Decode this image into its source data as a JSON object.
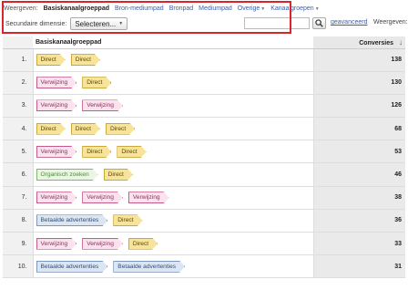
{
  "toolbar": {
    "view_label": "Weergeven:",
    "tabs": [
      {
        "label": "Basiskanaalgroeppad",
        "active": true,
        "caret": false
      },
      {
        "label": "Bron-mediumpad",
        "active": false,
        "caret": false
      },
      {
        "label": "Bronpad",
        "active": false,
        "caret": false
      },
      {
        "label": "Mediumpad",
        "active": false,
        "caret": false
      },
      {
        "label": "Overige",
        "active": false,
        "caret": true
      },
      {
        "label": "Kanaalgroepen",
        "active": false,
        "caret": true
      }
    ]
  },
  "secondary": {
    "label": "Secundaire dimensie:",
    "select_value": "Selecteren...",
    "search_value": "",
    "advanced_link": "geavanceerd",
    "view_label": "Weergeven:"
  },
  "table": {
    "col_path": "Basiskanaalgroeppad",
    "col_conversions": "Conversies",
    "rows": [
      {
        "num": "1.",
        "chips": [
          "Direct",
          "Direct"
        ],
        "value": "138"
      },
      {
        "num": "2.",
        "chips": [
          "Verwijzing",
          "Direct"
        ],
        "value": "130"
      },
      {
        "num": "3.",
        "chips": [
          "Verwijzing",
          "Verwijzing"
        ],
        "value": "126"
      },
      {
        "num": "4.",
        "chips": [
          "Direct",
          "Direct",
          "Direct"
        ],
        "value": "68"
      },
      {
        "num": "5.",
        "chips": [
          "Verwijzing",
          "Direct",
          "Direct"
        ],
        "value": "53"
      },
      {
        "num": "6.",
        "chips": [
          "Organisch zoeken",
          "Direct"
        ],
        "value": "46"
      },
      {
        "num": "7.",
        "chips": [
          "Verwijzing",
          "Verwijzing",
          "Verwijzing"
        ],
        "value": "38"
      },
      {
        "num": "8.",
        "chips": [
          "Betaalde advertenties",
          "Direct"
        ],
        "value": "36"
      },
      {
        "num": "9.",
        "chips": [
          "Verwijzing",
          "Verwijzing",
          "Direct"
        ],
        "value": "33"
      },
      {
        "num": "10.",
        "chips": [
          "Betaalde advertenties",
          "Betaalde advertenties"
        ],
        "value": "31"
      }
    ]
  },
  "chip_types": {
    "Direct": "chip-direct",
    "Verwijzing": "chip-verwijzing",
    "Organisch zoeken": "chip-organisch",
    "Betaalde advertenties": "chip-betaald"
  },
  "colors": {
    "highlight": "#d9232d",
    "direct": "#f7e49a",
    "verwijzing": "#fbe3ee",
    "organisch": "#eaf6e3",
    "betaald": "#dce6f3",
    "link": "#3b5ea8"
  }
}
